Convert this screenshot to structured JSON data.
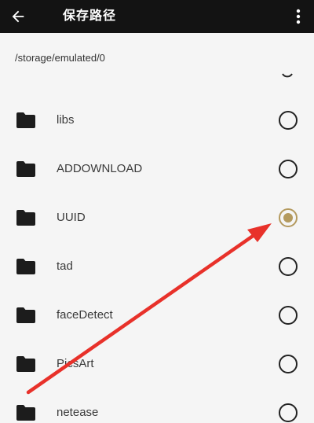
{
  "toolbar": {
    "title": "保存路径",
    "back_icon": "arrow-left-icon",
    "more_icon": "more-vertical-icon"
  },
  "path": {
    "current": "/storage/emulated/0"
  },
  "folders": [
    {
      "name": "libs",
      "selected": false
    },
    {
      "name": "ADDOWNLOAD",
      "selected": false
    },
    {
      "name": "UUID",
      "selected": true
    },
    {
      "name": "tad",
      "selected": false
    },
    {
      "name": "faceDetect",
      "selected": false
    },
    {
      "name": "PicsArt",
      "selected": false
    },
    {
      "name": "netease",
      "selected": false
    }
  ],
  "colors": {
    "toolbar_bg": "#131313",
    "radio_selected": "#b49a5e",
    "annotation_arrow": "#e8312a"
  },
  "annotation": {
    "type": "red-arrow",
    "points_to": "UUID"
  }
}
